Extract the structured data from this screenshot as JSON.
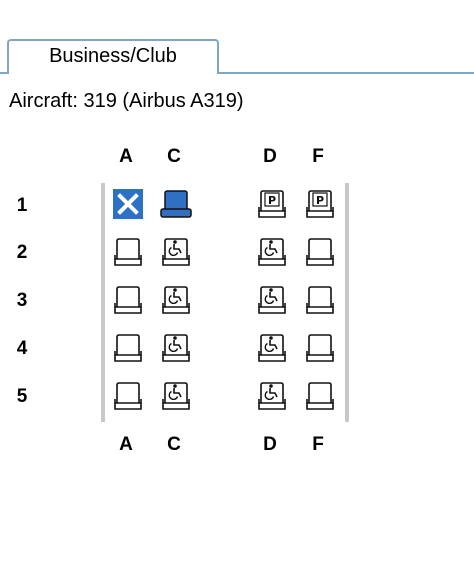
{
  "tab": {
    "label": "Business/Club"
  },
  "aircraft": {
    "label": "Aircraft: 319 (Airbus A319)"
  },
  "columns": {
    "a": "A",
    "c": "C",
    "d": "D",
    "f": "F"
  },
  "rows": [
    "1",
    "2",
    "3",
    "4",
    "5"
  ],
  "seat_status": {
    "1A": "unavailable",
    "1C": "selected",
    "1D": "premium",
    "1F": "premium",
    "2A": "available",
    "2C": "accessible",
    "2D": "accessible",
    "2F": "available",
    "3A": "available",
    "3C": "accessible",
    "3D": "accessible",
    "3F": "available",
    "4A": "available",
    "4C": "accessible",
    "4D": "accessible",
    "4F": "available",
    "5A": "available",
    "5C": "accessible",
    "5D": "accessible",
    "5F": "available"
  },
  "seat_glyphs": {
    "premium": "P"
  },
  "colors": {
    "tab_border": "#7fa6c9",
    "selected_seat": "#2f6fc4",
    "unavailable_seat": "#2b72c7"
  }
}
